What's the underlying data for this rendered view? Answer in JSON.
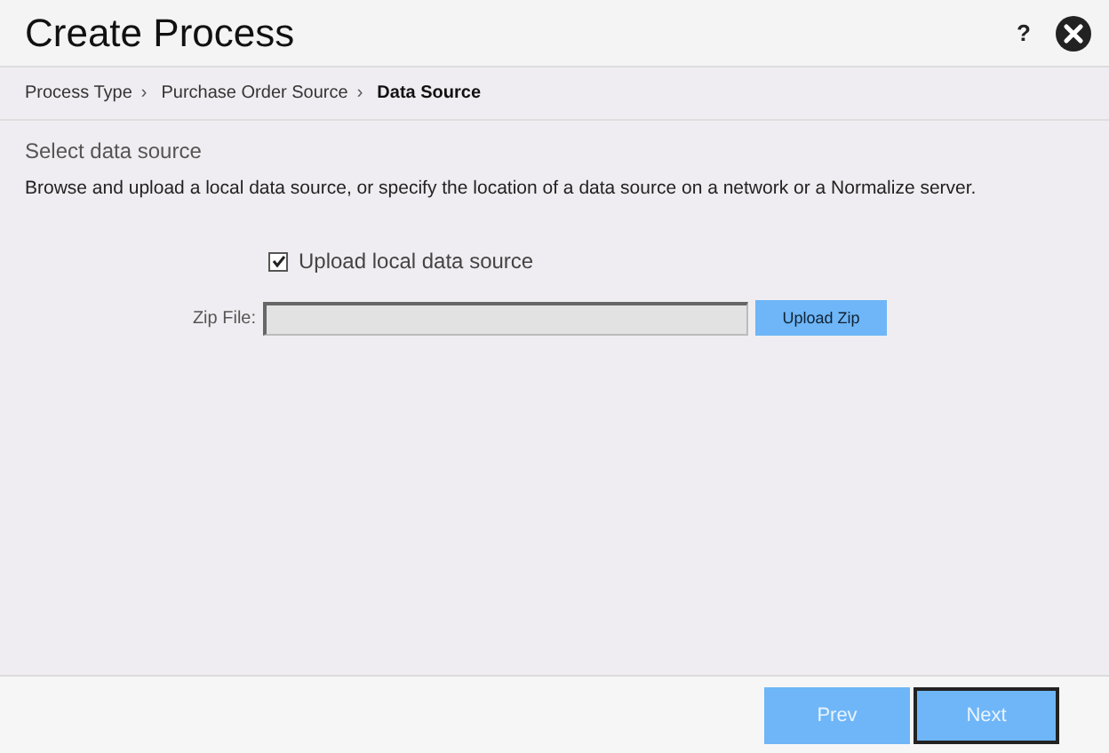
{
  "window": {
    "title": "Create Process",
    "help": "?"
  },
  "breadcrumb": [
    {
      "label": "Process Type",
      "separator": "›",
      "selected": false
    },
    {
      "label": "Purchase Order Source",
      "separator": "›",
      "selected": false
    },
    {
      "label": "Data Source",
      "selected": true
    }
  ],
  "section": {
    "title": "Select data source",
    "description": "Browse and upload a local data source, or specify the location of a data source on a network or a Normalize server."
  },
  "upload_option": {
    "label": "Upload local data source",
    "checked": true
  },
  "zip_file": {
    "label": "Zip File:",
    "button": "Upload Zip"
  },
  "buttons": [
    {
      "label": "Prev",
      "focused": false
    },
    {
      "label": "Next",
      "focused": true
    }
  ]
}
